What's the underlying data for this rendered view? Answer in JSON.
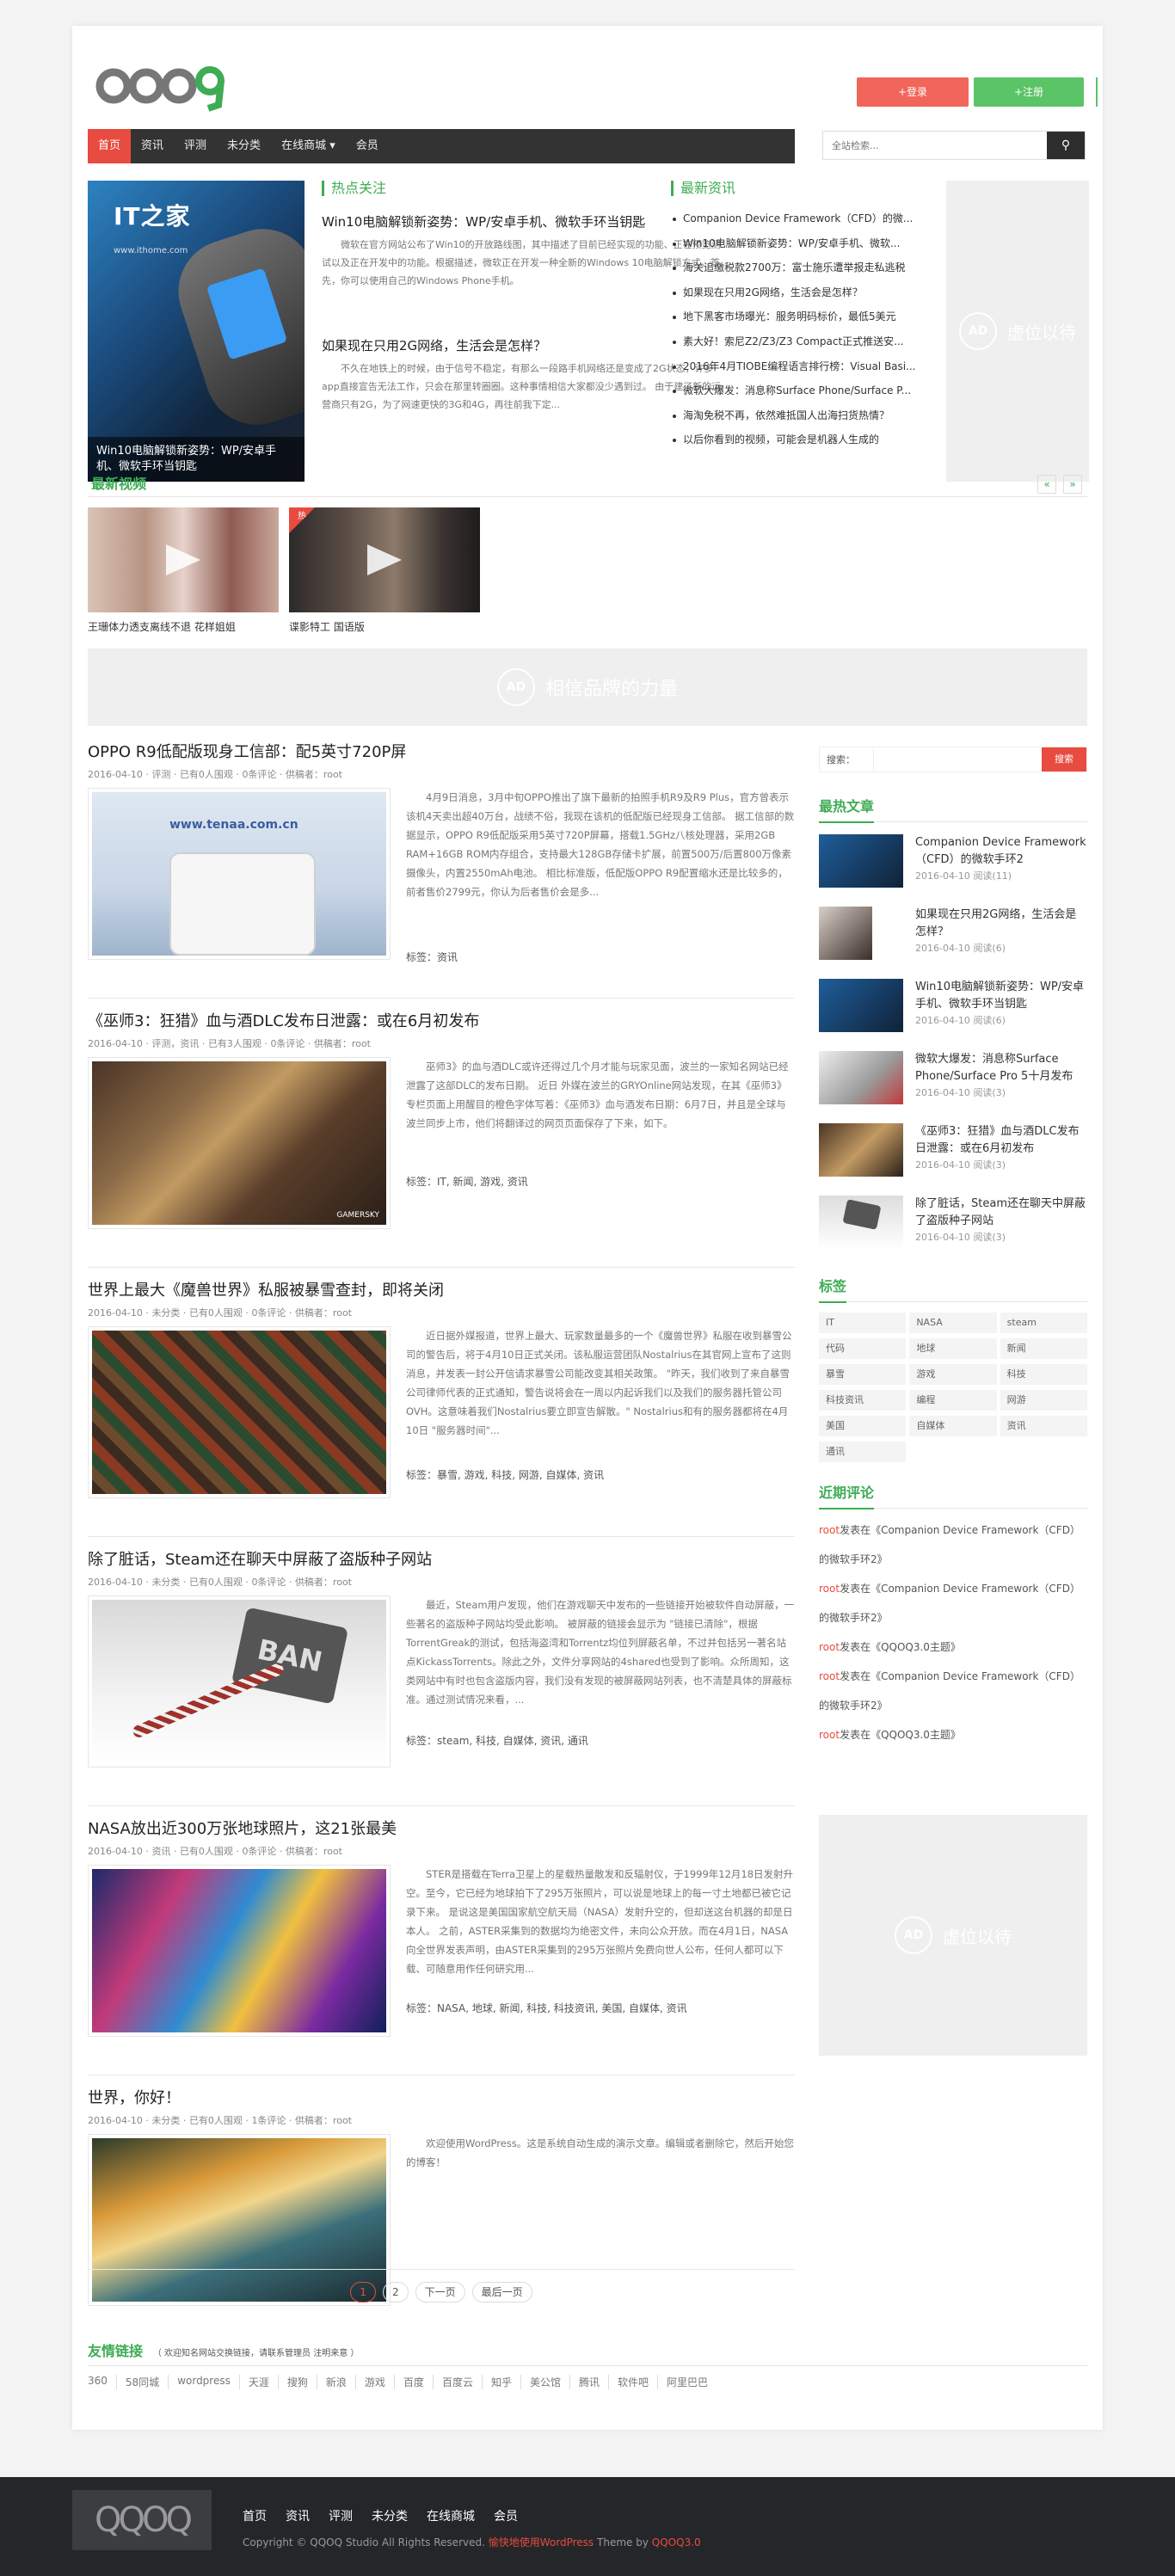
{
  "header": {
    "logo_text": "QQOQ",
    "login": "+登录",
    "register": "+注册",
    "search_placeholder": "全站检索..."
  },
  "nav": [
    "首页",
    "资讯",
    "评测",
    "未分类",
    "在线商城 ▾",
    "会员"
  ],
  "hero": {
    "caption": "Win10电脑解锁新姿势：WP/安卓手机、微软手环当钥匙",
    "logo": "IT之家",
    "url": "www.ithome.com"
  },
  "hot": {
    "title": "热点关注",
    "items": [
      {
        "title": "Win10电脑解锁新姿势：WP/安卓手机、微软手环当钥匙",
        "text": "微软在官方网站公布了Win10的开放路线图，其中描述了目前已经实现的功能、正在预览测试以及正在开发中的功能。根据描述，微软正在开发一种全新的Windows 10电脑解锁方式。首先，你可以使用自己的Windows Phone手机。"
      },
      {
        "title": "如果现在只用2G网络，生活会是怎样？",
        "text": "不久在地铁上的时候，由于信号不稳定，有那么一段路手机网络还是变成了2G状态，许多app直接宣告无法工作，只会在那里转圈圈。这种事情相信大家都没少遇到过。 由于建了新的运营商只有2G，为了网速更快的3G和4G，再往前我下定..."
      }
    ]
  },
  "latest": {
    "title": "最新资讯",
    "items": [
      "Companion Device Framework（CFD）的微...",
      "Win10电脑解锁新姿势：WP/安卓手机、微软...",
      "海关追缴税款2700万：富士施乐遭举报走私逃税",
      "如果现在只用2G网络，生活会是怎样？",
      "地下黑客市场曝光：服务明码标价，最低5美元",
      "素大好！索尼Z2/Z3/Z3 Compact正式推送安...",
      "2016年4月TIOBE编程语言排行榜：Visual Basi...",
      "微软大爆发：消息称Surface Phone/Surface P...",
      "海淘免税不再，依然难抵国人出海扫货热情？",
      "以后你看到的视频，可能会是机器人生成的"
    ]
  },
  "ad_text": "虚位以待",
  "ad_banner": "相信品牌的力量",
  "ad_label": "AD",
  "videos": {
    "title": "最新视频",
    "prev": "«",
    "next": "»",
    "items": [
      {
        "caption": "王珊体力透支离线不退 花样姐姐"
      },
      {
        "caption": "谍影特工 国语版",
        "badge": "热"
      }
    ]
  },
  "posts": [
    {
      "title": "OPPO R9低配版现身工信部：配5英寸720P屏",
      "meta": [
        "2016-04-10",
        "评测",
        "已有0人围观",
        "0条评论",
        "供稿者：root"
      ],
      "excerpt": "4月9日消息，3月中旬OPPO推出了旗下最新的拍照手机R9及R9 Plus，官方曾表示该机4天卖出超40万台，战绩不俗，我现在该机的低配版已经现身工信部。 据工信部的数据显示，OPPO R9低配版采用5英寸720P屏幕，搭载1.5GHz八核处理器，采用2GB RAM+16GB ROM内存组合，支持最大128GB存储卡扩展，前置500万/后置800万像素摄像头，内置2550mAh电池。 相比标准版，低配版OPPO R9配置缩水还是比较多的，前者售价2799元，你认为后者售价会是多...",
      "tags": "标签：资讯",
      "thumb_text": "www.tenaa.com.cn"
    },
    {
      "title": "《巫师3：狂猎》血与酒DLC发布日泄露：或在6月初发布",
      "meta": [
        "2016-04-10",
        "评测，资讯",
        "已有3人围观",
        "0条评论",
        "供稿者：root"
      ],
      "excerpt": "巫师3》的血与酒DLC或许还得过几个月才能与玩家见面，波兰的一家知名网站已经泄露了这部DLC的发布日期。 近日 外媒在波兰的GRYOnline网站发现，在其《巫师3》专栏页面上用醒目的橙色字体写着：《巫师3》血与酒发布日期：6月7日，并且是全球与波兰同步上市，他们将翻译过的网页页面保存了下来，如下。",
      "tags": "标签：IT, 新闻, 游戏, 资讯",
      "thumb_text": "GAMERSKY"
    },
    {
      "title": "世界上最大《魔兽世界》私服被暴雪查封，即将关闭",
      "meta": [
        "2016-04-10",
        "未分类",
        "已有0人围观",
        "0条评论",
        "供稿者：root"
      ],
      "excerpt": "近日据外媒报道，世界上最大、玩家数量最多的一个《魔兽世界》私服在收到暴雪公司的警告后，将于4月10日正式关闭。该私服运营团队Nostalrius在其官网上宣布了这则消息，并发表一封公开信请求暴雪公司能改变其相关政策。 \"昨天，我们收到了来自暴雪公司律师代表的正式通知，警告说将会在一周以内起诉我们以及我们的服务器托管公司OVH。这意味着我们Nostalrius要立即宣告解散。\" Nostalrius和有的服务器都将在4月10日 \"服务器时间\"...",
      "tags": "标签：暴雪, 游戏, 科技, 网游, 自媒体, 资讯",
      "thumb_text": ""
    },
    {
      "title": "除了脏话，Steam还在聊天中屏蔽了盗版种子网站",
      "meta": [
        "2016-04-10",
        "未分类",
        "已有0人围观",
        "0条评论",
        "供稿者：root"
      ],
      "excerpt": "最近，Steam用户发现，他们在游戏聊天中发布的一些链接开始被软件自动屏蔽，一些著名的盗版种子网站均受此影响。 被屏蔽的链接会显示为 \"链接已清除\"，根据TorrentGreak的测试，包括海盗湾和Torrentz均位列屏蔽名单，不过并包括另一著名站点KickassTorrents。除此之外，文件分享网站的4shared也受到了影响。众所周知，这类网站中有时也包含盗版内容，我们没有发现的被屏蔽网站列表，也不清楚具体的屏蔽标准。通过测试情况来看，...",
      "tags": "标签：steam, 科技, 自媒体, 资讯, 通讯",
      "thumb_text": "BAN"
    },
    {
      "title": "NASA放出近300万张地球照片，这21张最美",
      "meta": [
        "2016-04-10",
        "资讯",
        "已有0人围观",
        "0条评论",
        "供稿者：root"
      ],
      "excerpt": "STER是搭载在Terra卫星上的星载热量散发和反辐射仪，于1999年12月18日发射升空。至今，它已经为地球拍下了295万张照片，可以说是地球上的每一寸土地都已被它记录下来。 是说这是美国国家航空航天局（NASA）发射升空的，但却送这台机器的却是日本人。 之前，ASTER采集到的数据均为绝密文件，未向公众开放。而在4月1日，NASA向全世界发表声明，由ASTER采集到的295万张照片免费向世人公布，任何人都可以下载、可随意用作任何研究用...",
      "tags": "标签：NASA, 地球, 新闻, 科技, 科技资讯, 美国, 自媒体, 资讯",
      "thumb_text": ""
    },
    {
      "title": "世界，你好！",
      "meta": [
        "2016-04-10",
        "未分类",
        "已有0人围观",
        "1条评论",
        "供稿者：root"
      ],
      "excerpt": "欢迎使用WordPress。这是系统自动生成的演示文章。编辑或者删除它，然后开始您的博客！",
      "tags": "",
      "thumb_text": ""
    }
  ],
  "pager": {
    "items": [
      "1",
      "2",
      "下一页",
      "最后一页"
    ]
  },
  "friend_links": {
    "title": "友情链接",
    "note": "（ 欢迎知名网站交换链接，请联系管理员 注明来意 ）",
    "items": [
      "360",
      "58同城",
      "wordpress",
      "天涯",
      "搜狗",
      "新浪",
      "游戏",
      "百度",
      "百度云",
      "知乎",
      "美公馆",
      "腾讯",
      "软件吧",
      "阿里巴巴"
    ]
  },
  "sidebar": {
    "search_label": "搜索：",
    "search_btn": "搜索",
    "hot_title": "最热文章",
    "hot_posts": [
      {
        "title": "Companion Device Framework（CFD）的微软手环2",
        "date": "2016-04-10",
        "views": "阅读(11)"
      },
      {
        "title": "如果现在只用2G网络，生活会是怎样？",
        "date": "2016-04-10",
        "views": "阅读(6)"
      },
      {
        "title": "Win10电脑解锁新姿势：WP/安卓手机、微软手环当钥匙",
        "date": "2016-04-10",
        "views": "阅读(6)"
      },
      {
        "title": "微软大爆发：消息称Surface Phone/Surface Pro 5十月发布",
        "date": "2016-04-10",
        "views": "阅读(3)"
      },
      {
        "title": "《巫师3：狂猎》血与酒DLC发布日泄露：或在6月初发布",
        "date": "2016-04-10",
        "views": "阅读(3)"
      },
      {
        "title": "除了脏话，Steam还在聊天中屏蔽了盗版种子网站",
        "date": "2016-04-10",
        "views": "阅读(3)"
      }
    ],
    "tags_title": "标签",
    "tags": [
      "IT",
      "NASA",
      "steam",
      "代码",
      "地球",
      "新闻",
      "暴雪",
      "游戏",
      "科技",
      "科技资讯",
      "编程",
      "网游",
      "美国",
      "自媒体",
      "资讯",
      "通讯"
    ],
    "comments_title": "近期评论",
    "comments": [
      {
        "author": "root",
        "text": "发表在《Companion Device Framework（CFD）的微软手环2》"
      },
      {
        "author": "root",
        "text": "发表在《Companion Device Framework（CFD）的微软手环2》"
      },
      {
        "author": "root",
        "text": "发表在《QQOQ3.0主题》"
      },
      {
        "author": "root",
        "text": "发表在《Companion Device Framework（CFD）的微软手环2》"
      },
      {
        "author": "root",
        "text": "发表在《QQOQ3.0主题》"
      }
    ]
  },
  "footer": {
    "logo": "QQOQ",
    "nav": [
      "首页",
      "资讯",
      "评测",
      "未分类",
      "在线商城",
      "会员"
    ],
    "copy": "Copyright © QQOQ Studio All Rights Reserved.",
    "powered": "愉快地使用WordPress",
    "theme": "Theme by",
    "theme_name": "QQOQ3.0"
  }
}
